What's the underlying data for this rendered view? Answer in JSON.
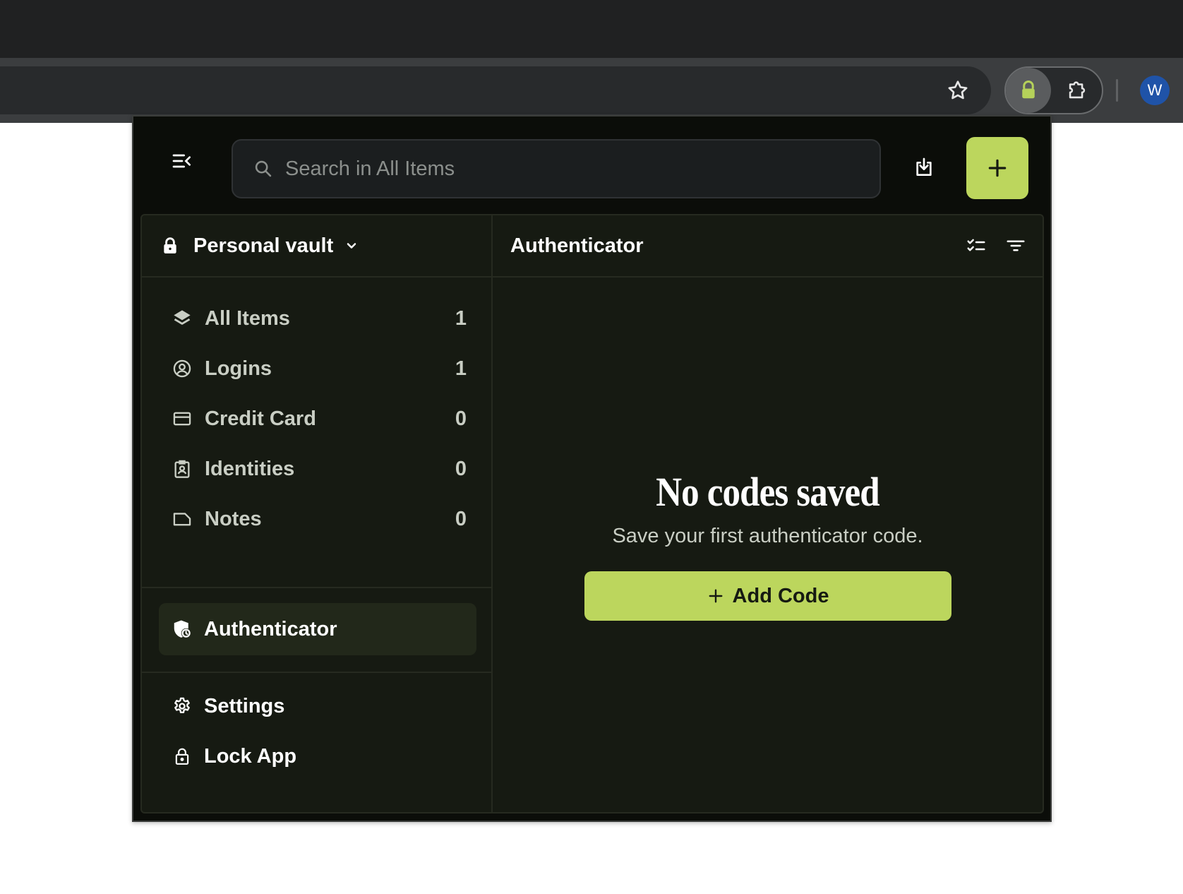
{
  "browser": {
    "profile_initial": "W"
  },
  "popup": {
    "search": {
      "placeholder": "Search in All Items",
      "value": ""
    },
    "accent_color": "#bcd65d",
    "vault": {
      "name": "Personal vault"
    },
    "categories": [
      {
        "label": "All Items",
        "count": "1",
        "icon": "layers-icon"
      },
      {
        "label": "Logins",
        "count": "1",
        "icon": "user-circle-icon"
      },
      {
        "label": "Credit Card",
        "count": "0",
        "icon": "credit-card-icon"
      },
      {
        "label": "Identities",
        "count": "0",
        "icon": "id-badge-icon"
      },
      {
        "label": "Notes",
        "count": "0",
        "icon": "note-icon"
      }
    ],
    "authenticator_label": "Authenticator",
    "bottom_menu": {
      "settings_label": "Settings",
      "lock_label": "Lock App"
    },
    "main": {
      "title": "Authenticator",
      "empty_title": "No codes saved",
      "empty_subtitle": "Save your first authenticator code.",
      "add_code_label": "Add Code"
    }
  }
}
